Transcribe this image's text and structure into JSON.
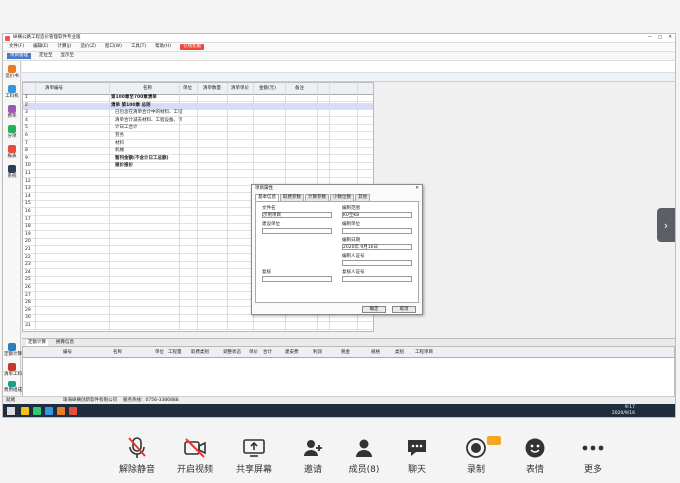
{
  "colors": {
    "accent": "#4a79c5",
    "taskbar": "#1f2d3d",
    "red_muted": "#e53935",
    "badge": "#f6a623"
  },
  "screen": {
    "window_title": "纵横公路工程造价管理软件专业版",
    "title_controls": [
      "—",
      "□",
      "✕"
    ],
    "menu": [
      "文件(F)",
      "编辑(E)",
      "计算(J)",
      "造价(Z)",
      "窗口(W)",
      "工具(T)",
      "帮助(H)"
    ],
    "menu_red": "在线客服",
    "toolbar": [
      "项目管理",
      "定位至",
      "显示至"
    ],
    "sidebar": [
      "造价书",
      "工料机",
      "费率",
      "分项",
      "报表",
      "系统"
    ],
    "sidebar_lower": [
      "定额计算",
      "清单工料",
      "费用组成"
    ],
    "grid_headers": [
      "清单编号",
      "名称",
      "单位",
      "清单数量",
      "清单单价",
      "金额(元)",
      "备注"
    ],
    "grid_rows": [
      "第100章至700章清单",
      "清单 第100章 总则",
      "已包含在清单合计中的材料、工程",
      "清单合计减去材料、工程设备、专",
      "计日工合计",
      "劳务",
      "材料",
      "机械",
      "暂列金额(不含计日工总额)",
      "报价报价"
    ],
    "row_numbers": [
      "1",
      "2",
      "3",
      "4",
      "5",
      "6",
      "7",
      "8",
      "9",
      "10",
      "11",
      "12",
      "13",
      "14",
      "15",
      "16",
      "17",
      "18",
      "19",
      "20",
      "21",
      "22",
      "23",
      "24",
      "25",
      "26",
      "27",
      "28",
      "29",
      "30",
      "31"
    ],
    "lower_tabs": [
      "定额计算",
      "换算信息"
    ],
    "lower_headers": [
      "编号",
      "名称",
      "单位",
      "工程量",
      "取费类别",
      "调整状态",
      "单价",
      "合计",
      "建安费",
      "利润",
      "税金",
      "规格",
      "类别",
      "工程项目"
    ],
    "dialog": {
      "title": "项目属性",
      "close": "✕",
      "tabs": [
        "基本信息",
        "取费参数",
        "计算参数",
        "小数位数",
        "其他"
      ],
      "labels": [
        "文件名",
        "编制范围",
        "建设单位",
        "编制单位",
        "编制日期",
        "编制人证号",
        "复核",
        "复核人证号"
      ],
      "values": [
        "示例项目",
        "K0至K8",
        "",
        "",
        "2020年 9月16日",
        "",
        "",
        ""
      ],
      "ok": "确定",
      "cancel": "取消"
    },
    "status": {
      "left": "就绪",
      "company": "珠海纵横创新软件有限公司",
      "phone": "服务热线：0756-3386888"
    },
    "clock": {
      "time": "9:17",
      "date": "2020/9/16"
    }
  },
  "meeting": {
    "items": [
      {
        "label": "解除静音",
        "icon": "mic-muted-icon"
      },
      {
        "label": "开启视频",
        "icon": "camera-off-icon"
      },
      {
        "label": "共享屏幕",
        "icon": "share-screen-icon"
      },
      {
        "label": "邀请",
        "icon": "invite-icon"
      },
      {
        "label": "成员(8)",
        "icon": "members-icon"
      },
      {
        "label": "聊天",
        "icon": "chat-icon"
      },
      {
        "label": "录制",
        "icon": "record-icon"
      },
      {
        "label": "表情",
        "icon": "emoji-icon"
      },
      {
        "label": "更多",
        "icon": "more-icon"
      }
    ],
    "side_arrow": "›"
  }
}
